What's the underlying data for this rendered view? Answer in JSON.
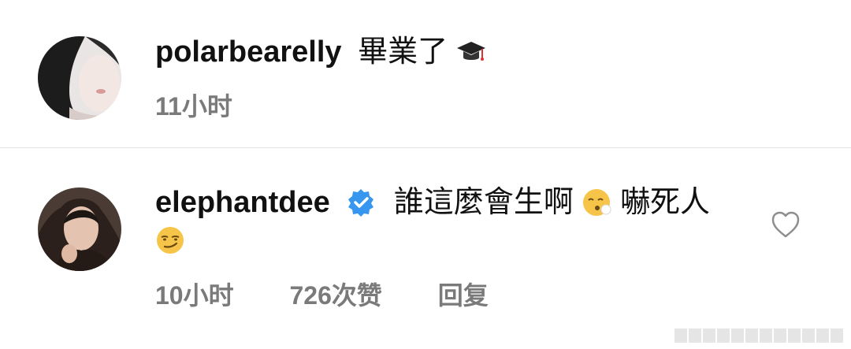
{
  "comments": [
    {
      "username": "polarbearelly",
      "text": "畢業了",
      "emoji_after": "graduation-cap",
      "time": "11小时"
    },
    {
      "username": "elephantdee",
      "verified": true,
      "text_line1": "誰這麼會生啊",
      "text_line1b": "嚇死人",
      "time": "10小时",
      "likes": "726次赞",
      "reply_label": "回复"
    }
  ],
  "colors": {
    "meta": "#7a7a7a",
    "verified": "#3797f0",
    "divider": "#e3e3e3"
  }
}
